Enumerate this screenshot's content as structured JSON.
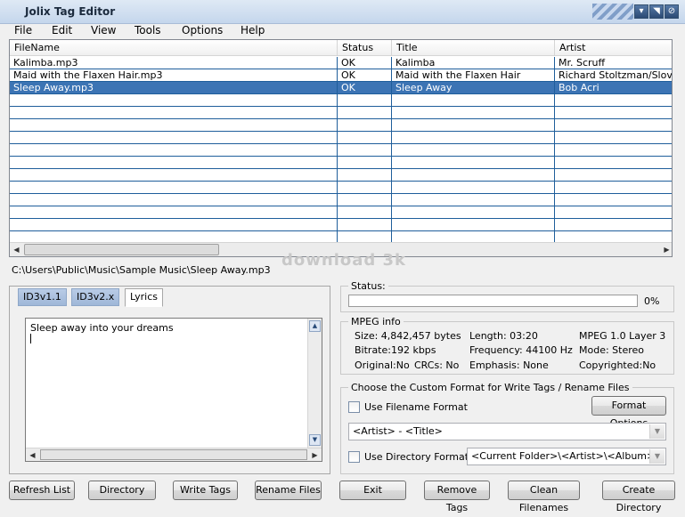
{
  "window": {
    "title": "Jolix Tag Editor",
    "buttons": {
      "minimize": "▾",
      "restore": "◥",
      "close": "⊘"
    }
  },
  "menu": [
    {
      "label": "File"
    },
    {
      "label": "Edit"
    },
    {
      "label": "View"
    },
    {
      "label": "Tools"
    },
    {
      "label": "Options"
    },
    {
      "label": "Help"
    }
  ],
  "file_list": {
    "columns": [
      "FileName",
      "Status",
      "Title",
      "Artist"
    ],
    "rows": [
      {
        "filename": "Kalimba.mp3",
        "status": "OK",
        "title": "Kalimba",
        "artist": "Mr. Scruff"
      },
      {
        "filename": "Maid with the Flaxen Hair.mp3",
        "status": "OK",
        "title": "Maid with the Flaxen Hair",
        "artist": "Richard Stoltzman/Slovak"
      },
      {
        "filename": "Sleep Away.mp3",
        "status": "OK",
        "title": "Sleep Away",
        "artist": "Bob Acri"
      }
    ],
    "selected_index": 2,
    "scroll_left": "◀",
    "scroll_right": "▶"
  },
  "current_path": "C:\\Users\\Public\\Music\\Sample Music\\Sleep Away.mp3",
  "watermark": "download 3k",
  "tabs": [
    {
      "label": "ID3v1.1"
    },
    {
      "label": "ID3v2.x"
    },
    {
      "label": "Lyrics"
    }
  ],
  "lyrics": {
    "text": "Sleep away into your dreams"
  },
  "status": {
    "label": "Status:",
    "progress": 0,
    "progress_text": "0%"
  },
  "mpeg_info": {
    "label": "MPEG info",
    "size": "Size: 4,842,457 bytes",
    "length": "Length:  03:20",
    "layer": "MPEG 1.0 Layer 3",
    "bitrate": "Bitrate:192 kbps",
    "frequency": "Frequency: 44100 Hz",
    "mode": "Mode: Stereo",
    "original": "Original:No",
    "crcs": "CRCs: No",
    "emphasis": "Emphasis: None",
    "copyrighted": "Copyrighted:No"
  },
  "custom_format": {
    "label": "Choose the Custom Format for Write Tags / Rename Files",
    "use_filename_format": "Use Filename Format",
    "use_filename_format_checked": false,
    "format_options": "Format Options",
    "filename_format": "<Artist> - <Title>",
    "use_directory_format": "Use Directory Format",
    "use_directory_format_checked": false,
    "directory_format": "<Current Folder>\\<Artist>\\<Album>\\"
  },
  "buttons": {
    "refresh_list": "Refresh List",
    "directory": "Directory",
    "write_tags": "Write Tags",
    "rename_files": "Rename Files",
    "exit": "Exit",
    "remove_tags": "Remove Tags",
    "clean_filenames": "Clean Filenames",
    "create_directory": "Create Directory"
  }
}
